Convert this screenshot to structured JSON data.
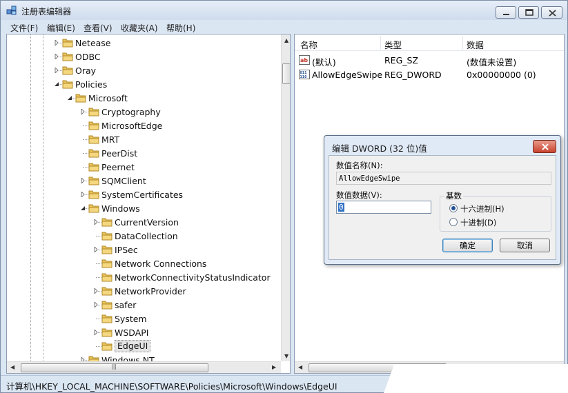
{
  "window": {
    "title": "注册表编辑器"
  },
  "menu": [
    "文件(F)",
    "编辑(E)",
    "查看(V)",
    "收藏夹(A)",
    "帮助(H)"
  ],
  "tree": [
    {
      "label": "Netease",
      "level": 0,
      "expander": "collapsed"
    },
    {
      "label": "ODBC",
      "level": 0,
      "expander": "collapsed"
    },
    {
      "label": "Oray",
      "level": 0,
      "expander": "collapsed"
    },
    {
      "label": "Policies",
      "level": 0,
      "expander": "expanded"
    },
    {
      "label": "Microsoft",
      "level": 1,
      "expander": "expanded"
    },
    {
      "label": "Cryptography",
      "level": 2,
      "expander": "collapsed"
    },
    {
      "label": "MicrosoftEdge",
      "level": 2,
      "expander": "none"
    },
    {
      "label": "MRT",
      "level": 2,
      "expander": "none"
    },
    {
      "label": "PeerDist",
      "level": 2,
      "expander": "none"
    },
    {
      "label": "Peernet",
      "level": 2,
      "expander": "none"
    },
    {
      "label": "SQMClient",
      "level": 2,
      "expander": "collapsed"
    },
    {
      "label": "SystemCertificates",
      "level": 2,
      "expander": "collapsed"
    },
    {
      "label": "Windows",
      "level": 2,
      "expander": "expanded"
    },
    {
      "label": "CurrentVersion",
      "level": 3,
      "expander": "collapsed"
    },
    {
      "label": "DataCollection",
      "level": 3,
      "expander": "none"
    },
    {
      "label": "IPSec",
      "level": 3,
      "expander": "collapsed"
    },
    {
      "label": "Network Connections",
      "level": 3,
      "expander": "none"
    },
    {
      "label": "NetworkConnectivityStatusIndicator",
      "level": 3,
      "expander": "none"
    },
    {
      "label": "NetworkProvider",
      "level": 3,
      "expander": "collapsed"
    },
    {
      "label": "safer",
      "level": 3,
      "expander": "collapsed"
    },
    {
      "label": "System",
      "level": 3,
      "expander": "none"
    },
    {
      "label": "WSDAPI",
      "level": 3,
      "expander": "collapsed"
    },
    {
      "label": "EdgeUI",
      "level": 3,
      "expander": "none",
      "selected": true
    },
    {
      "label": "Windows NT",
      "level": 2,
      "expander": "collapsed"
    }
  ],
  "list": {
    "headers": {
      "name": "名称",
      "type": "类型",
      "data": "数据"
    },
    "rows": [
      {
        "icon": "string-value-icon",
        "name": "(默认)",
        "type": "REG_SZ",
        "data": "(数值未设置)"
      },
      {
        "icon": "dword-value-icon",
        "name": "AllowEdgeSwipe",
        "type": "REG_DWORD",
        "data": "0x00000000 (0)"
      }
    ]
  },
  "status": {
    "path": "计算机\\HKEY_LOCAL_MACHINE\\SOFTWARE\\Policies\\Microsoft\\Windows\\EdgeUI"
  },
  "dialog": {
    "title": "编辑 DWORD (32 位)值",
    "name_label": "数值名称(N):",
    "name_value": "AllowEdgeSwipe",
    "data_label": "数值数据(V):",
    "data_value": "0",
    "radix_label": "基数",
    "radix_hex": "十六进制(H)",
    "radix_dec": "十进制(D)",
    "radix_selected": "hex",
    "ok": "确定",
    "cancel": "取消"
  },
  "colors": {
    "chrome": "#dbe6f3",
    "folder": "#e8c35a",
    "selection": "#3373c6"
  }
}
